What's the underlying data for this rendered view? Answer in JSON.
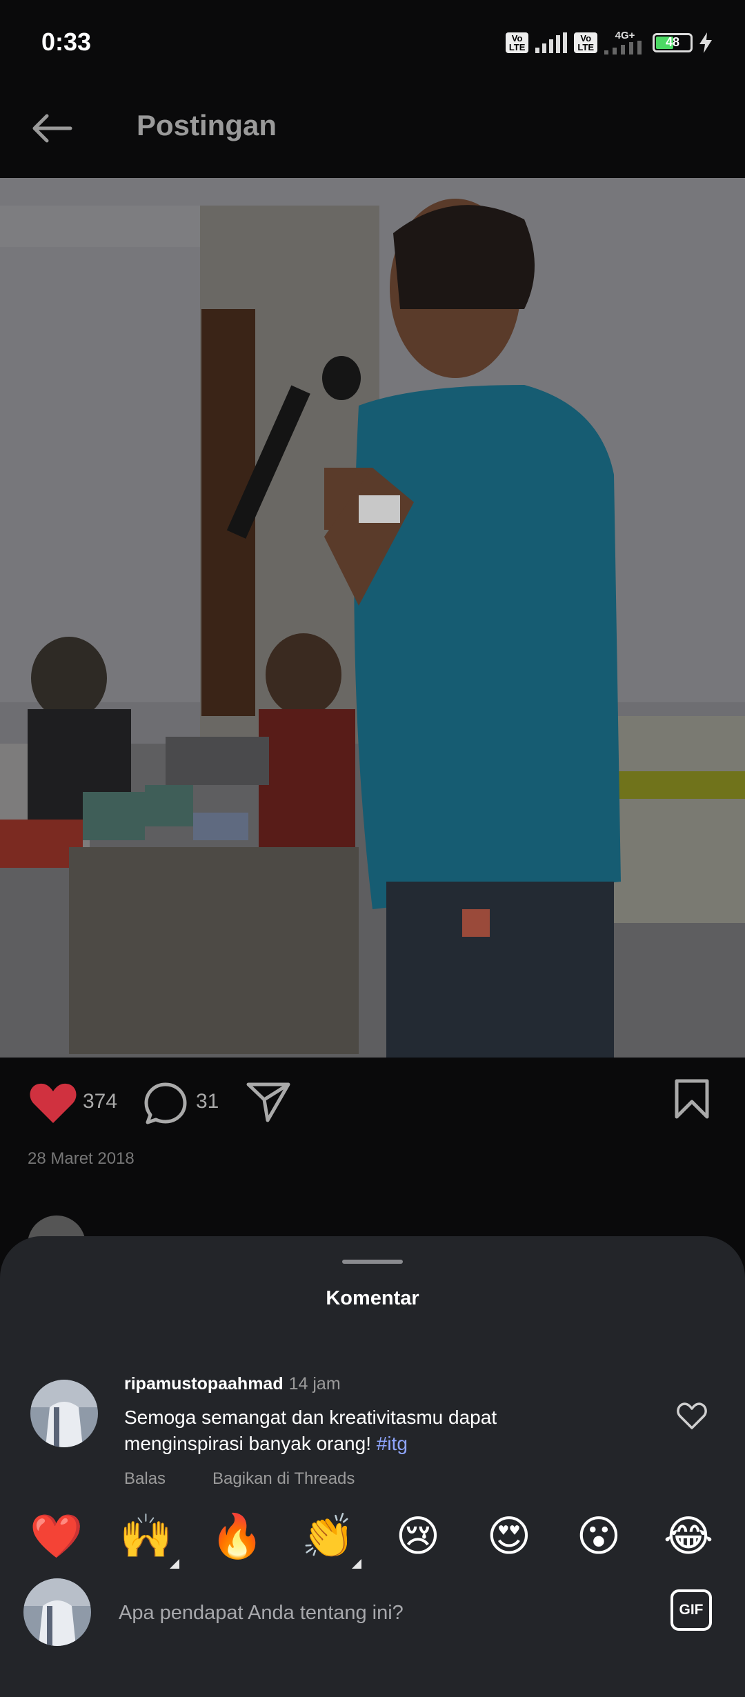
{
  "status_bar": {
    "time": "0:33",
    "volte_label": "Vo\nLTE",
    "network_label": "4G+",
    "battery_percent": "48"
  },
  "header": {
    "title": "Postingan"
  },
  "post": {
    "likes": "374",
    "comments": "31",
    "date": "28 Maret 2018"
  },
  "comments_sheet": {
    "title": "Komentar",
    "comment": {
      "username": "ripamustopaahmad",
      "time": "14 jam",
      "text": "Semoga semangat dan kreativitasmu dapat menginspirasi banyak orang!",
      "hashtag": "#itg",
      "reply_label": "Balas",
      "share_label": "Bagikan di Threads"
    },
    "emojis": [
      "❤️",
      "🙌",
      "🔥",
      "👏",
      "😢",
      "😍",
      "😮",
      "😂"
    ],
    "input_placeholder": "Apa pendapat Anda tentang ini?",
    "gif_label": "GIF"
  },
  "icons": [
    "back-arrow-icon",
    "heart-filled-icon",
    "comment-icon",
    "share-icon",
    "bookmark-icon",
    "heart-outline-icon",
    "gif-icon"
  ],
  "colors": {
    "like_red": "#d0313f",
    "hashtag": "#8fa6ff",
    "sheet_bg": "#232529"
  }
}
